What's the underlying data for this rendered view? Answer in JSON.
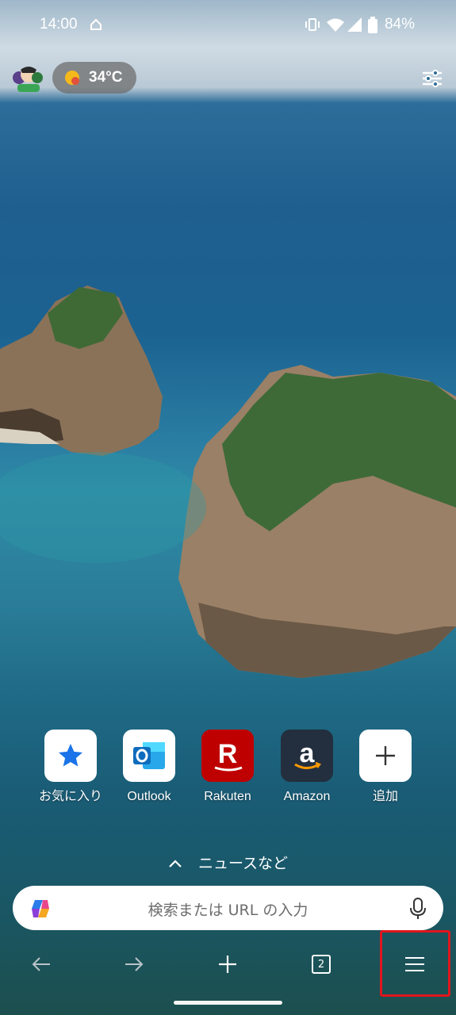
{
  "status_bar": {
    "time": "14:00",
    "battery": "84%"
  },
  "header": {
    "temperature": "34°C"
  },
  "quick_links": [
    {
      "label": "お気に入り",
      "icon": "star-icon"
    },
    {
      "label": "Outlook",
      "icon": "outlook-icon"
    },
    {
      "label": "Rakuten",
      "icon": "rakuten-icon"
    },
    {
      "label": "Amazon",
      "icon": "amazon-icon"
    },
    {
      "label": "追加",
      "icon": "plus-icon"
    }
  ],
  "news": {
    "label": "ニュースなど"
  },
  "search": {
    "placeholder": "検索または URL の入力"
  },
  "bottom_bar": {
    "tab_count": "2"
  },
  "colors": {
    "highlight": "#e0161e",
    "rakuten": "#bf0000",
    "amazon_bg": "#232f3e",
    "star": "#1a73e8"
  }
}
